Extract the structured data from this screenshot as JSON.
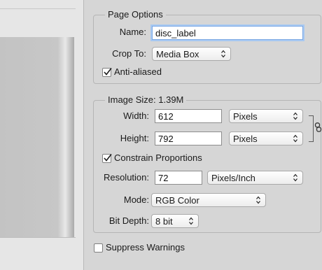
{
  "page_options": {
    "title": "Page Options",
    "name_label": "Name:",
    "name_value": "disc_label",
    "crop_label": "Crop To:",
    "crop_value": "Media Box",
    "antialiased_label": "Anti-aliased",
    "antialiased_checked": true
  },
  "image_size": {
    "title": "Image Size: 1.39M",
    "width_label": "Width:",
    "width_value": "612",
    "width_unit": "Pixels",
    "height_label": "Height:",
    "height_value": "792",
    "height_unit": "Pixels",
    "constrain_label": "Constrain Proportions",
    "constrain_checked": true,
    "resolution_label": "Resolution:",
    "resolution_value": "72",
    "resolution_unit": "Pixels/Inch",
    "mode_label": "Mode:",
    "mode_value": "RGB Color",
    "bitdepth_label": "Bit Depth:",
    "bitdepth_value": "8 bit"
  },
  "suppress": {
    "label": "Suppress Warnings",
    "checked": false
  },
  "icons": {
    "select_arrows": "chevron-updown-icon",
    "checkmark": "checkmark-icon",
    "constrain_link": "chain-link-icon"
  },
  "colors": {
    "dialog_bg": "#d6d6d6",
    "focus_ring": "#a8c9f2",
    "preview_canvas": "#c3c3c3"
  }
}
